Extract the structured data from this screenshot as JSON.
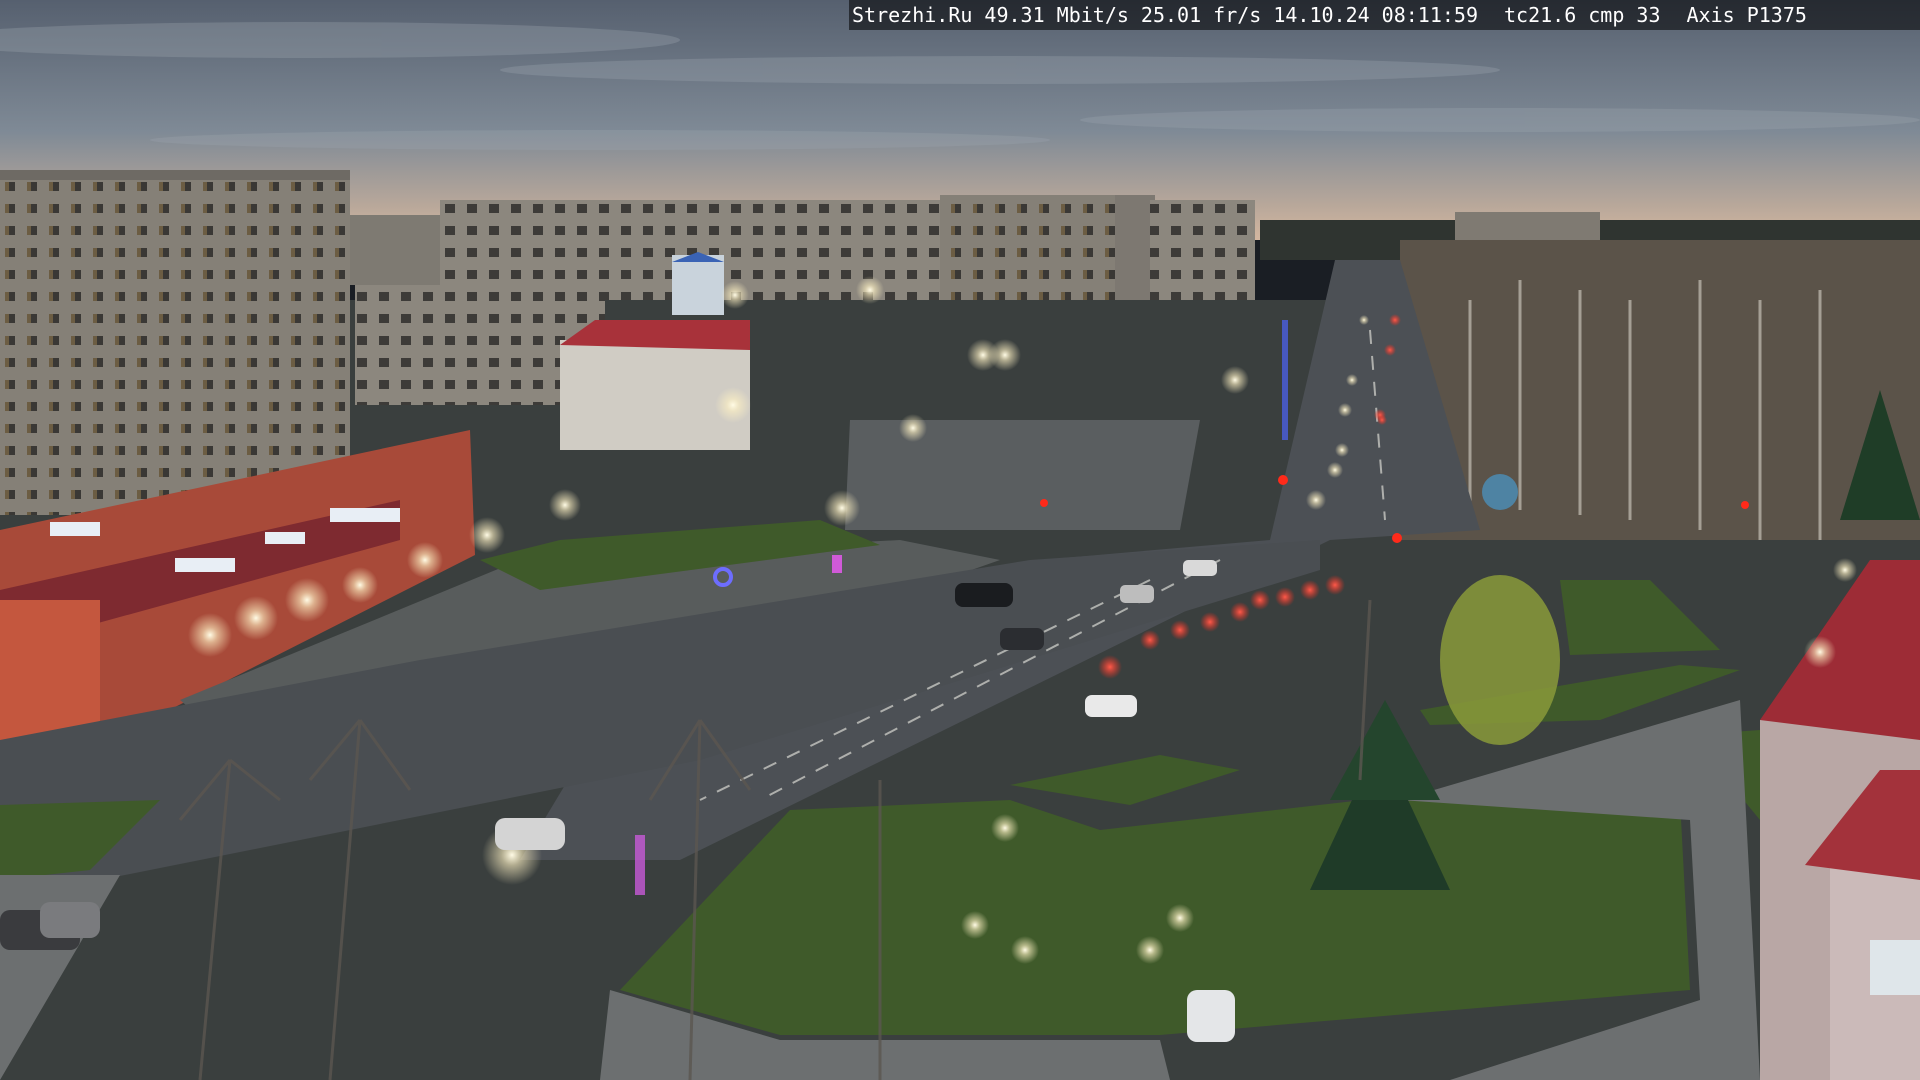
{
  "overlay": {
    "site": "Strezhi.Ru",
    "bitrate": "49.31 Mbit/s",
    "framerate": "25.01 fr/s",
    "date": "14.10.24",
    "time": "08:11:59",
    "tc": "tc21.6",
    "cmp": "cmp 33",
    "camera_model": "Axis P1375"
  },
  "colors": {
    "sky_top": "#4a5566",
    "sky_horizon": "#c9b3a0",
    "road": "#4e5257",
    "grass": "#3f5a2a",
    "building": "#8a857d",
    "shop_red": "#b84a36",
    "red_roof": "#a0282e",
    "tail_light": "#ff3030",
    "street_light": "#fff6d6"
  }
}
